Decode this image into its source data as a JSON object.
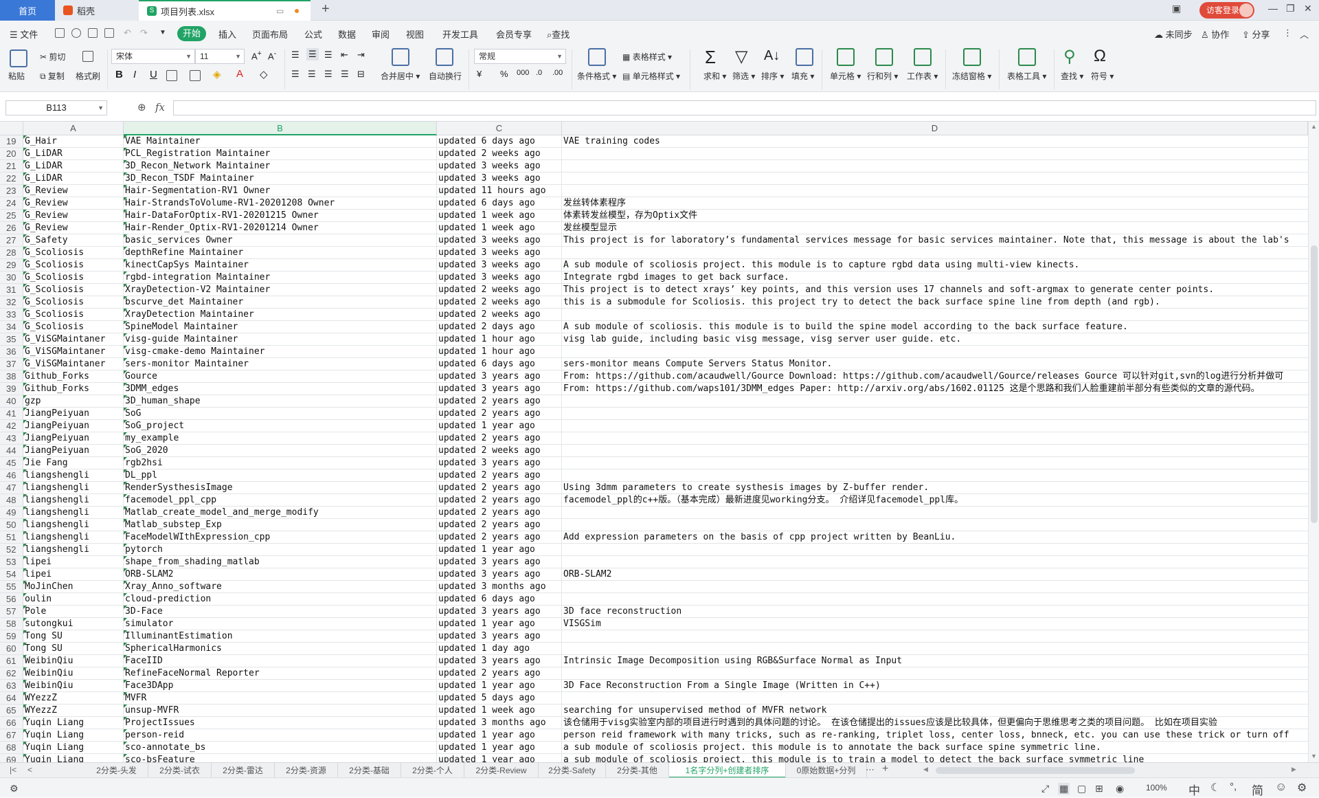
{
  "tabs": {
    "home": "首页",
    "daoke": "稻壳",
    "file": "项目列表.xlsx",
    "visitor_login": "访客登录"
  },
  "menu": {
    "file_menu": "文件",
    "items": [
      "开始",
      "插入",
      "页面布局",
      "公式",
      "数据",
      "审阅",
      "视图",
      "开发工具",
      "会员专享",
      "查找"
    ],
    "unsynced": "未同步",
    "collaborate": "协作",
    "share": "分享"
  },
  "ribbon": {
    "paste": "粘贴",
    "cut": "剪切",
    "copy": "复制",
    "format_painter": "格式刷",
    "font_name": "宋体",
    "font_size": "11",
    "bold": "B",
    "italic": "I",
    "underline": "U",
    "merge_center": "合并居中",
    "wrap_text": "自动换行",
    "number_format": "常规",
    "currency": "¥",
    "percent": "%",
    "thousands": "000",
    "cond_format": "条件格式",
    "table_style": "表格样式",
    "cell_style": "单元格样式",
    "sum": "求和",
    "filter": "筛选",
    "sort": "排序",
    "fill": "填充",
    "cell": "单元格",
    "rows_cols": "行和列",
    "worksheet": "工作表",
    "freeze": "冻结窗格",
    "table_tools": "表格工具",
    "find": "查找",
    "symbol": "符号"
  },
  "formula_bar": {
    "name_box": "B113",
    "fx": "fx"
  },
  "columns": [
    "A",
    "B",
    "C",
    "D"
  ],
  "rows": [
    {
      "n": "19",
      "a": "G_Hair",
      "b": "VAE Maintainer",
      "c": "updated 6 days ago",
      "d": "VAE training codes"
    },
    {
      "n": "20",
      "a": "G_LiDAR",
      "b": "PCL_Registration Maintainer",
      "c": "updated 2 weeks ago",
      "d": ""
    },
    {
      "n": "21",
      "a": "G_LiDAR",
      "b": "3D_Recon_Network Maintainer",
      "c": "updated 3 weeks ago",
      "d": ""
    },
    {
      "n": "22",
      "a": "G_LiDAR",
      "b": "3D_Recon_TSDF Maintainer",
      "c": "updated 3 weeks ago",
      "d": ""
    },
    {
      "n": "23",
      "a": "G_Review",
      "b": "Hair-Segmentation-RV1 Owner",
      "c": "updated 11 hours ago",
      "d": ""
    },
    {
      "n": "24",
      "a": "G_Review",
      "b": "Hair-StrandsToVolume-RV1-20201208 Owner",
      "c": "updated 6 days ago",
      "d": "发丝转体素程序"
    },
    {
      "n": "25",
      "a": "G_Review",
      "b": "Hair-DataForOptix-RV1-20201215 Owner",
      "c": "updated 1 week ago",
      "d": "体素转发丝模型，存为Optix文件"
    },
    {
      "n": "26",
      "a": "G_Review",
      "b": "Hair-Render_Optix-RV1-20201214 Owner",
      "c": "updated 1 week ago",
      "d": "发丝模型显示"
    },
    {
      "n": "27",
      "a": "G_Safety",
      "b": "basic_services Owner",
      "c": "updated 3 weeks ago",
      "d": "This project is for laboratory’s fundamental services message for basic services maintainer. Note that, this message is about the lab's"
    },
    {
      "n": "28",
      "a": "G_Scoliosis",
      "b": "depthRefine Maintainer",
      "c": "updated 3 weeks ago",
      "d": ""
    },
    {
      "n": "29",
      "a": "G_Scoliosis",
      "b": "kinectCapSys Maintainer",
      "c": "updated 3 weeks ago",
      "d": "A sub module of scoliosis project. this module is to capture rgbd data using multi-view kinects."
    },
    {
      "n": "30",
      "a": "G_Scoliosis",
      "b": "rgbd-integration Maintainer",
      "c": "updated 3 weeks ago",
      "d": "Integrate rgbd images to get back surface."
    },
    {
      "n": "31",
      "a": "G_Scoliosis",
      "b": "XrayDetection-V2 Maintainer",
      "c": "updated 2 weeks ago",
      "d": "This project is to detect xrays’ key points, and this version uses 17 channels and soft-argmax to generate center points."
    },
    {
      "n": "32",
      "a": "G_Scoliosis",
      "b": "bscurve_det Maintainer",
      "c": "updated 2 weeks ago",
      "d": "this is a submodule for Scoliosis. this project try to detect the back surface spine line from depth (and rgb)."
    },
    {
      "n": "33",
      "a": "G_Scoliosis",
      "b": "XrayDetection Maintainer",
      "c": "updated 2 weeks ago",
      "d": ""
    },
    {
      "n": "34",
      "a": "G_Scoliosis",
      "b": "SpineModel Maintainer",
      "c": "updated 2 days ago",
      "d": "A sub module of scoliosis. this module is to build the spine model according to the back surface feature."
    },
    {
      "n": "35",
      "a": "G_ViSGMaintaner",
      "b": "visg-guide Maintainer",
      "c": "updated 1 hour ago",
      "d": "visg lab guide, including basic visg message, visg server user guide. etc."
    },
    {
      "n": "36",
      "a": "G_ViSGMaintaner",
      "b": "visg-cmake-demo Maintainer",
      "c": "updated 1 hour ago",
      "d": ""
    },
    {
      "n": "37",
      "a": "G_ViSGMaintaner",
      "b": "sers-monitor Maintainer",
      "c": "updated 6 days ago",
      "d": "sers-monitor means Compute Servers Status Monitor."
    },
    {
      "n": "38",
      "a": "Github_Forks",
      "b": "Gource",
      "c": "updated 3 years ago",
      "d": "From: https://github.com/acaudwell/Gource Download: https://github.com/acaudwell/Gource/releases Gource 可以针对git,svn的log进行分析并做可"
    },
    {
      "n": "39",
      "a": "Github_Forks",
      "b": "3DMM_edges",
      "c": "updated 3 years ago",
      "d": "From: https://github.com/waps101/3DMM_edges Paper: http://arxiv.org/abs/1602.01125 这是个思路和我们人脸重建前半部分有些类似的文章的源代码。"
    },
    {
      "n": "40",
      "a": "gzp",
      "b": "3D_human_shape",
      "c": "updated 2 years ago",
      "d": ""
    },
    {
      "n": "41",
      "a": "JiangPeiyuan",
      "b": "SoG",
      "c": "updated 2 years ago",
      "d": ""
    },
    {
      "n": "42",
      "a": "JiangPeiyuan",
      "b": "SoG_project",
      "c": "updated 1 year ago",
      "d": ""
    },
    {
      "n": "43",
      "a": "JiangPeiyuan",
      "b": "my_example",
      "c": "updated 2 years ago",
      "d": ""
    },
    {
      "n": "44",
      "a": "JiangPeiyuan",
      "b": "SoG_2020",
      "c": "updated 2 weeks ago",
      "d": ""
    },
    {
      "n": "45",
      "a": "Jie Fang",
      "b": "rgb2hsi",
      "c": "updated 3 years ago",
      "d": ""
    },
    {
      "n": "46",
      "a": "liangshengli",
      "b": "DL_ppl",
      "c": "updated 2 years ago",
      "d": ""
    },
    {
      "n": "47",
      "a": "liangshengli",
      "b": "RenderSysthesisImage",
      "c": "updated 2 years ago",
      "d": "Using 3dmm parameters to create systhesis images by Z-buffer render."
    },
    {
      "n": "48",
      "a": "liangshengli",
      "b": "facemodel_ppl_cpp",
      "c": "updated 2 years ago",
      "d": "facemodel_ppl的c++版。（基本完成）最新进度见working分支。 介绍详见facemodel_ppl库。"
    },
    {
      "n": "49",
      "a": "liangshengli",
      "b": "Matlab_create_model_and_merge_modify",
      "c": "updated 2 years ago",
      "d": ""
    },
    {
      "n": "50",
      "a": "liangshengli",
      "b": "Matlab_substep_Exp",
      "c": "updated 2 years ago",
      "d": ""
    },
    {
      "n": "51",
      "a": "liangshengli",
      "b": "FaceModelWIthExpression_cpp",
      "c": "updated 2 years ago",
      "d": "Add expression parameters on the basis of cpp project written by BeanLiu."
    },
    {
      "n": "52",
      "a": "liangshengli",
      "b": "pytorch",
      "c": "updated 1 year ago",
      "d": ""
    },
    {
      "n": "53",
      "a": "lipei",
      "b": "shape_from_shading_matlab",
      "c": "updated 3 years ago",
      "d": ""
    },
    {
      "n": "54",
      "a": "lipei",
      "b": "ORB-SLAM2",
      "c": "updated 3 years ago",
      "d": "ORB-SLAM2"
    },
    {
      "n": "55",
      "a": "MoJinChen",
      "b": "Xray_Anno_software",
      "c": "updated 3 months ago",
      "d": ""
    },
    {
      "n": "56",
      "a": "oulin",
      "b": "cloud-prediction",
      "c": "updated 6 days ago",
      "d": ""
    },
    {
      "n": "57",
      "a": "Pole",
      "b": "3D-Face",
      "c": "updated 3 years ago",
      "d": "3D face reconstruction"
    },
    {
      "n": "58",
      "a": "sutongkui",
      "b": "simulator",
      "c": "updated 1 year ago",
      "d": "VISGSim"
    },
    {
      "n": "59",
      "a": "Tong SU",
      "b": "IlluminantEstimation",
      "c": "updated 3 years ago",
      "d": ""
    },
    {
      "n": "60",
      "a": "Tong SU",
      "b": "SphericalHarmonics",
      "c": "updated 1 day ago",
      "d": ""
    },
    {
      "n": "61",
      "a": "WeibinQiu",
      "b": "FaceIID",
      "c": "updated 3 years ago",
      "d": "Intrinsic Image Decomposition using RGB&Surface Normal as Input"
    },
    {
      "n": "62",
      "a": "WeibinQiu",
      "b": "RefineFaceNormal Reporter",
      "c": "updated 2 years ago",
      "d": ""
    },
    {
      "n": "63",
      "a": "WeibinQiu",
      "b": "Face3DApp",
      "c": "updated 1 year ago",
      "d": "3D Face Reconstruction From a Single Image (Written in C++)"
    },
    {
      "n": "64",
      "a": "WYezzZ",
      "b": "MVFR",
      "c": "updated 5 days ago",
      "d": ""
    },
    {
      "n": "65",
      "a": "WYezzZ",
      "b": "unsup-MVFR",
      "c": "updated 1 week ago",
      "d": "searching for unsupervised method of MVFR network"
    },
    {
      "n": "66",
      "a": "Yuqin Liang",
      "b": "ProjectIssues",
      "c": "updated 3 months ago",
      "d": "该仓储用于visg实验室内部的项目进行时遇到的具体问题的讨论。 在该仓储提出的issues应该是比较具体，但更偏向于思维思考之类的项目问题。 比如在项目实验"
    },
    {
      "n": "67",
      "a": "Yuqin Liang",
      "b": "person-reid",
      "c": "updated 1 year ago",
      "d": "person reid framework with many tricks, such as re-ranking, triplet loss, center loss, bnneck, etc. you can use these trick or turn off"
    },
    {
      "n": "68",
      "a": "Yuqin Liang",
      "b": "sco-annotate_bs",
      "c": "updated 1 year ago",
      "d": "a sub module of scoliosis project. this module is to annotate the back surface spine symmetric line."
    },
    {
      "n": "69",
      "a": "Yuqin Liang",
      "b": "sco-bsFeature",
      "c": "updated 1 year ago",
      "d": "a sub module of scoliosis project. this module is to train a model to detect the back surface symmetric line"
    }
  ],
  "sheets": {
    "items": [
      "2分类-头发",
      "2分类-试衣",
      "2分类-雷达",
      "2分类-资源",
      "2分类-基础",
      "2分类-个人",
      "2分类-Review",
      "2分类-Safety",
      "2分类-其他",
      "1名字分列+创建者排序",
      "0原始数据+分列"
    ],
    "active_index": 9
  },
  "status": {
    "zoom": "100%",
    "ime_lang": "中",
    "ime_mode": "简"
  },
  "colors": {
    "accent": "#21a366",
    "home_tab": "#3a78d8",
    "visitor": "#e04a3a"
  }
}
